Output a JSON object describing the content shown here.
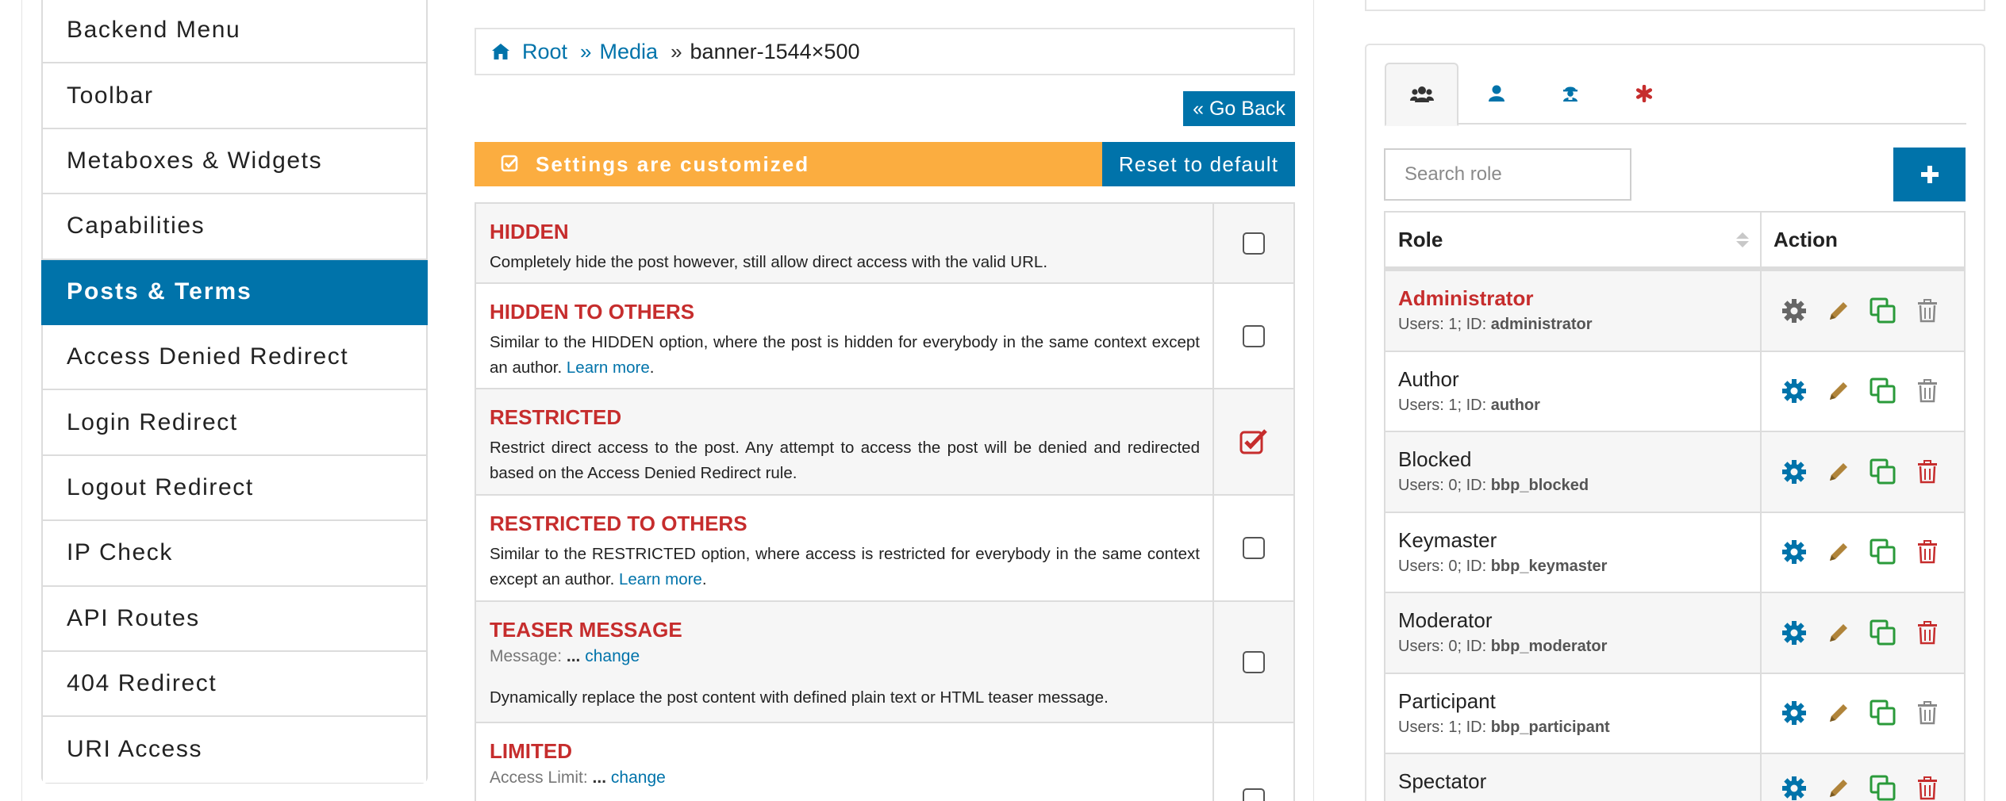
{
  "sidebar": {
    "items": [
      {
        "label": "Backend Menu"
      },
      {
        "label": "Toolbar"
      },
      {
        "label": "Metaboxes & Widgets"
      },
      {
        "label": "Capabilities"
      },
      {
        "label": "Posts & Terms",
        "active": true
      },
      {
        "label": "Access Denied Redirect"
      },
      {
        "label": "Login Redirect"
      },
      {
        "label": "Logout Redirect"
      },
      {
        "label": "IP Check"
      },
      {
        "label": "API Routes"
      },
      {
        "label": "404 Redirect"
      },
      {
        "label": "URI Access"
      }
    ]
  },
  "breadcrumb": {
    "root": "Root",
    "media": "Media",
    "current": "banner-1544×500"
  },
  "go_back_label": "« Go Back",
  "customized": {
    "message": "Settings are customized",
    "reset_label": "Reset to default"
  },
  "options": [
    {
      "title": "HIDDEN",
      "desc": "Completely hide the post however, still allow direct access with the valid URL.",
      "checked": false
    },
    {
      "title": "HIDDEN TO OTHERS",
      "desc": "Similar to the HIDDEN option, where the post is hidden for everybody in the same context except an author.",
      "link": "Learn more",
      "checked": false
    },
    {
      "title": "RESTRICTED",
      "desc": "Restrict direct access to the post. Any attempt to access the post will be denied and redirected based on the Access Denied Redirect rule.",
      "checked": true
    },
    {
      "title": "RESTRICTED TO OTHERS",
      "desc": "Similar to the RESTRICTED option, where access is restricted for everybody in the same context except an author.",
      "link": "Learn more",
      "checked": false
    },
    {
      "title": "TEASER MESSAGE",
      "sub_label": "Message:",
      "sub_value": "...",
      "sub_link": "change",
      "desc": "Dynamically replace the post content with defined plain text or HTML teaser message.",
      "checked": false
    },
    {
      "title": "LIMITED",
      "sub_label": "Access Limit:",
      "sub_value": "...",
      "sub_link": "change",
      "checked": false
    }
  ],
  "tabs": [
    {
      "icon": "users-icon",
      "active": true
    },
    {
      "icon": "user-icon"
    },
    {
      "icon": "visitor-icon"
    },
    {
      "icon": "default-asterisk-icon"
    }
  ],
  "search": {
    "placeholder": "Search role"
  },
  "roles_table": {
    "headers": {
      "role": "Role",
      "action": "Action"
    },
    "rows": [
      {
        "name": "Administrator",
        "meta_prefix": "Users: 1; ID:",
        "id": "administrator",
        "admin": true
      },
      {
        "name": "Author",
        "meta_prefix": "Users: 1; ID:",
        "id": "author"
      },
      {
        "name": "Blocked",
        "meta_prefix": "Users: 0; ID:",
        "id": "bbp_blocked"
      },
      {
        "name": "Keymaster",
        "meta_prefix": "Users: 0; ID:",
        "id": "bbp_keymaster"
      },
      {
        "name": "Moderator",
        "meta_prefix": "Users: 0; ID:",
        "id": "bbp_moderator"
      },
      {
        "name": "Participant",
        "meta_prefix": "Users: 1; ID:",
        "id": "bbp_participant"
      },
      {
        "name": "Spectator",
        "meta_prefix": "",
        "id": ""
      }
    ]
  },
  "colors": {
    "accent": "#0073aa",
    "warning": "#fbad40",
    "danger": "#c62d2d",
    "edit": "#b0843a",
    "clone": "#2a9a3a"
  }
}
